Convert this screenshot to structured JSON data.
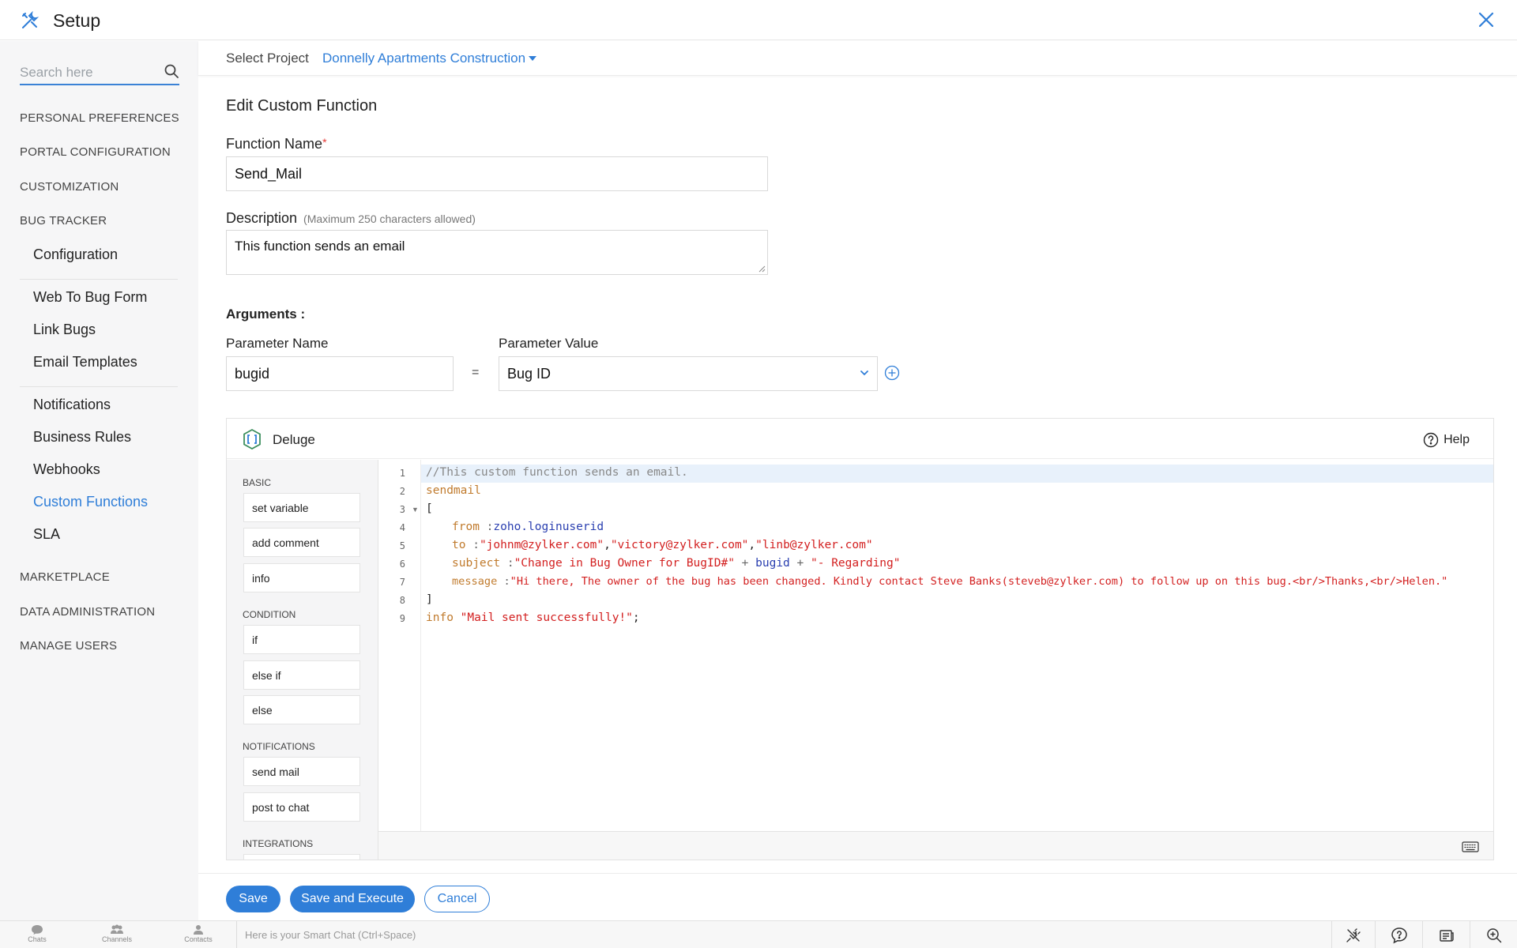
{
  "app": {
    "title": "Setup"
  },
  "search": {
    "placeholder": "Search here"
  },
  "sidebar": {
    "sections": [
      "PERSONAL PREFERENCES",
      "PORTAL CONFIGURATION",
      "CUSTOMIZATION",
      "BUG TRACKER"
    ],
    "bug_tracker_items": [
      "Configuration",
      "Web To Bug Form",
      "Link Bugs",
      "Email Templates",
      "Notifications",
      "Business Rules",
      "Webhooks",
      "Custom Functions",
      "SLA"
    ],
    "active_item": "Custom Functions",
    "sections_after": [
      "MARKETPLACE",
      "DATA ADMINISTRATION",
      "MANAGE USERS"
    ]
  },
  "project": {
    "label": "Select Project",
    "value": "Donnelly Apartments Construction"
  },
  "form": {
    "title": "Edit Custom Function",
    "function_name_label": "Function Name",
    "required_mark": "*",
    "function_name_value": "Send_Mail",
    "description_label": "Description",
    "description_hint": "(Maximum 250 characters allowed)",
    "description_value": "This function sends an email",
    "arguments_label": "Arguments :",
    "param_name_label": "Parameter Name",
    "param_value_label": "Parameter Value",
    "param_name_value": "bugid",
    "equals": "=",
    "param_value_selected": "Bug ID"
  },
  "editor": {
    "name": "Deluge",
    "help_label": "Help",
    "palette": {
      "basic_label": "BASIC",
      "basic": [
        "set variable",
        "add comment",
        "info"
      ],
      "condition_label": "CONDITION",
      "condition": [
        "if",
        "else if",
        "else"
      ],
      "notifications_label": "NOTIFICATIONS",
      "notifications": [
        "send mail",
        "post to chat"
      ],
      "integrations_label": "INTEGRATIONS"
    },
    "line_numbers": [
      "1",
      "2",
      "3",
      "4",
      "5",
      "6",
      "7",
      "8",
      "9"
    ],
    "code": {
      "l1": "//This custom function sends an email.",
      "l2": "sendmail",
      "l3": "[",
      "l4_key": "from",
      "l4_sep": " :",
      "l4_val": "zoho.loginuserid",
      "l5_key": "to",
      "l5_sep": " :",
      "l5_s1": "\"johnm@zylker.com\"",
      "l5_c1": ",",
      "l5_s2": "\"victory@zylker.com\"",
      "l5_c2": ",",
      "l5_s3": "\"linb@zylker.com\"",
      "l6_key": "subject",
      "l6_sep": " :",
      "l6_s1": "\"Change in Bug Owner for BugID#\"",
      "l6_p1": " + ",
      "l6_var": "bugid",
      "l6_p2": " + ",
      "l6_s2": "\"- Regarding\"",
      "l7_key": "message",
      "l7_sep": " :",
      "l7_s1": "\"Hi there, The owner of the bug has been changed. Kindly contact Steve Banks(steveb@zylker.com) to follow up on this bug.<br/>Thanks,<br/>Helen.\"",
      "l8": "]",
      "l9_kw": "info",
      "l9_str": " \"Mail sent successfully!\"",
      "l9_end": ";"
    }
  },
  "buttons": {
    "save": "Save",
    "save_execute": "Save and Execute",
    "cancel": "Cancel"
  },
  "chatbar": {
    "tabs": [
      "Chats",
      "Channels",
      "Contacts"
    ],
    "placeholder": "Here is your Smart Chat (Ctrl+Space)"
  },
  "colors": {
    "accent": "#2f7ed8",
    "sidebar_bg": "#f6f6f7",
    "required": "#e53935"
  }
}
